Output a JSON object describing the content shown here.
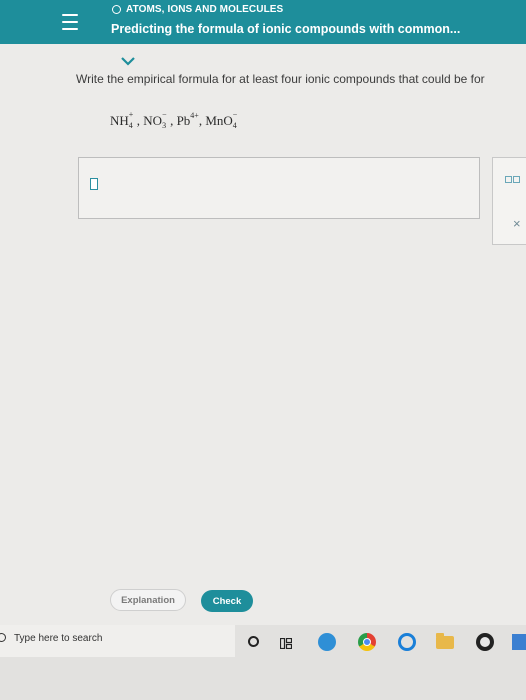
{
  "header": {
    "topic": "ATOMS, IONS AND MOLECULES",
    "lesson_title": "Predicting the formula of ionic compounds with common..."
  },
  "question": {
    "text": "Write the empirical formula for at least four ionic compounds that could be for",
    "ions": [
      {
        "base": "NH",
        "sub": "4",
        "sup": "+"
      },
      {
        "base": "NO",
        "sub": "3",
        "sup": "−"
      },
      {
        "base": "Pb",
        "sub": "",
        "sup": "4+"
      },
      {
        "base": "MnO",
        "sub": "4",
        "sup": "−"
      }
    ],
    "separator": ", "
  },
  "answer": {
    "value": ""
  },
  "side_panel": {
    "close_glyph": "×"
  },
  "buttons": {
    "explanation": "Explanation",
    "check": "Check"
  },
  "taskbar": {
    "search_placeholder": "Type here to search"
  },
  "colors": {
    "accent": "#1e8e9b"
  }
}
